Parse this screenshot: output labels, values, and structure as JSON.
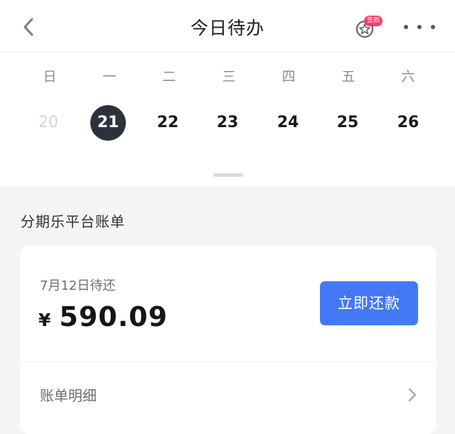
{
  "nav": {
    "title": "今日待办",
    "back_icon": "chevron-left-icon",
    "sign_in_badge": "签到",
    "sign_in_icon": "star-sticker-icon",
    "more_icon": "more-dots-icon"
  },
  "calendar": {
    "weekdays": [
      "日",
      "一",
      "二",
      "三",
      "四",
      "五",
      "六"
    ],
    "dates": [
      "20",
      "21",
      "22",
      "23",
      "24",
      "25",
      "26"
    ],
    "today_index": 1
  },
  "bill": {
    "section_title": "分期乐平台账单",
    "due_label": "7月12日待还",
    "currency": "¥",
    "amount": "590.09",
    "pay_button": "立即还款",
    "detail_label": "账单明细",
    "detail_icon": "chevron-right-icon"
  },
  "colors": {
    "accent": "#4378f6",
    "today_bg": "#2c323b",
    "badge": "#ff3a67"
  }
}
